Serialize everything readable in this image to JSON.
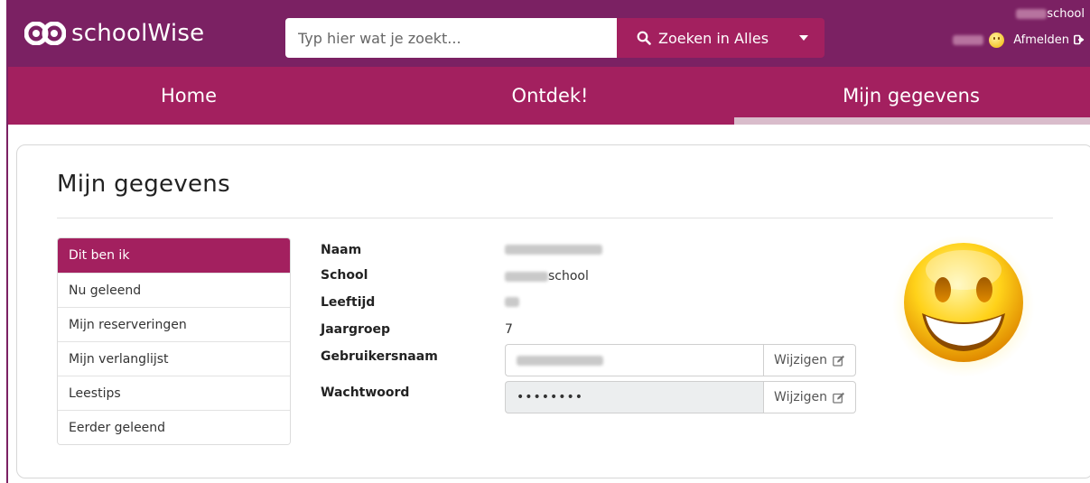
{
  "brand": {
    "name": "schoolWise",
    "logo_icon": "infinity-logo-icon"
  },
  "search": {
    "placeholder": "Typ hier wat je zoekt...",
    "button_label": "Zoeken in Alles",
    "button_icon": "search-icon",
    "dropdown_icon": "caret-down-icon"
  },
  "user": {
    "school_suffix": "school",
    "logout_label": "Afmelden",
    "logout_icon": "sign-out-icon",
    "avatar_icon": "smiley-icon"
  },
  "nav": {
    "items": [
      {
        "label": "Home"
      },
      {
        "label": "Ontdek!"
      },
      {
        "label": "Mijn gegevens"
      }
    ],
    "active_index": 2
  },
  "page": {
    "title": "Mijn gegevens"
  },
  "side_menu": {
    "items": [
      {
        "label": "Dit ben ik"
      },
      {
        "label": "Nu geleend"
      },
      {
        "label": "Mijn reserveringen"
      },
      {
        "label": "Mijn verlanglijst"
      },
      {
        "label": "Leestips"
      },
      {
        "label": "Eerder geleend"
      }
    ],
    "active_index": 0
  },
  "profile": {
    "labels": {
      "name": "Naam",
      "school": "School",
      "age": "Leeftijd",
      "grade": "Jaargroep",
      "username": "Gebruikersnaam",
      "password": "Wachtwoord"
    },
    "school_suffix": "school",
    "grade_value": "7",
    "password_mask": "••••••••",
    "change_label": "Wijzigen",
    "change_icon": "edit-icon",
    "avatar_icon": "big-smiley-icon"
  },
  "colors": {
    "topbar": "#7b2163",
    "navbar": "#a3205f",
    "active_bar": "#d9bccb",
    "accent": "#a3205f"
  }
}
